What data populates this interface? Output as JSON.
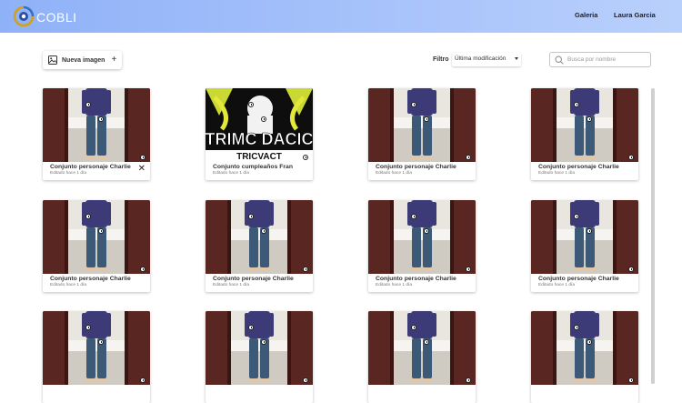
{
  "header": {
    "brand": "COBLI",
    "nav": {
      "gallery": "Galeria",
      "user": "Laura Garcia"
    }
  },
  "toolbar": {
    "new_image_label": "Nueva imagen",
    "filter_label": "Filtro",
    "filter_value": "Última modificación",
    "search_placeholder": "Busca por nombre"
  },
  "cards": [
    {
      "title": "Conjunto personaje Charlie",
      "meta": "Editado hace 1 día",
      "image": "person-photo",
      "show_close": true
    },
    {
      "title": "Conjunto cumpleaños Fran",
      "meta": "Editado hace 1 día",
      "image": "tshirt-design",
      "show_close": false
    },
    {
      "title": "Conjunto personaje Charlie",
      "meta": "Editado hace 1 día",
      "image": "person-photo",
      "show_close": false
    },
    {
      "title": "Conjunto personaje Charlie",
      "meta": "Editado hace 1 día",
      "image": "person-photo",
      "show_close": false
    },
    {
      "title": "Conjunto personaje Charlie",
      "meta": "Editado hace 1 día",
      "image": "person-photo",
      "show_close": false
    },
    {
      "title": "Conjunto personaje Charlie",
      "meta": "Editado hace 1 día",
      "image": "person-photo",
      "show_close": false
    },
    {
      "title": "Conjunto personaje Charlie",
      "meta": "Editado hace 1 día",
      "image": "person-photo",
      "show_close": false
    },
    {
      "title": "Conjunto personaje Charlie",
      "meta": "Editado hace 1 día",
      "image": "person-photo",
      "show_close": false
    },
    {
      "title": "",
      "meta": "",
      "image": "person-photo",
      "show_close": false
    },
    {
      "title": "",
      "meta": "",
      "image": "person-photo",
      "show_close": false
    },
    {
      "title": "",
      "meta": "",
      "image": "person-photo",
      "show_close": false
    },
    {
      "title": "",
      "meta": "",
      "image": "person-photo",
      "show_close": false
    }
  ],
  "design_text": {
    "line1": "TRIMC DACIC",
    "line2": "TRICVACT"
  },
  "colors": {
    "header_start": "#8fb1f7",
    "header_end": "#b9d0fc",
    "wall": "#5a2621",
    "shirt": "#3d3a78",
    "jeans": "#3c5a78"
  }
}
